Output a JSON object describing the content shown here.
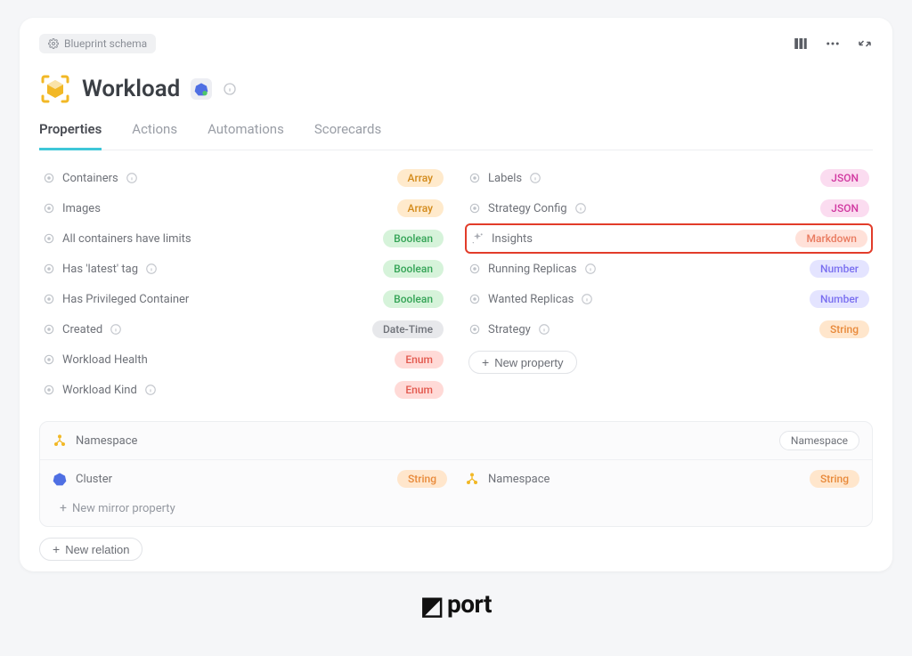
{
  "top": {
    "schema_chip": "Blueprint schema"
  },
  "title": "Workload",
  "tabs": {
    "properties": "Properties",
    "actions": "Actions",
    "automations": "Automations",
    "scorecards": "Scorecards"
  },
  "types": {
    "array": "Array",
    "json": "JSON",
    "boolean": "Boolean",
    "datetime": "Date-Time",
    "enum": "Enum",
    "number": "Number",
    "string": "String",
    "markdown": "Markdown"
  },
  "left_props": [
    {
      "name": "Containers",
      "type": "array",
      "info": true
    },
    {
      "name": "Images",
      "type": "array",
      "info": false
    },
    {
      "name": "All containers have limits",
      "type": "boolean",
      "info": false
    },
    {
      "name": "Has 'latest' tag",
      "type": "boolean",
      "info": true
    },
    {
      "name": "Has Privileged Container",
      "type": "boolean",
      "info": false
    },
    {
      "name": "Created",
      "type": "datetime",
      "info": true
    },
    {
      "name": "Workload Health",
      "type": "enum",
      "info": false
    },
    {
      "name": "Workload Kind",
      "type": "enum",
      "info": true
    }
  ],
  "right_props": [
    {
      "name": "Labels",
      "type": "json",
      "info": true,
      "ai": false
    },
    {
      "name": "Strategy Config",
      "type": "json",
      "info": true,
      "ai": false
    },
    {
      "name": "Insights",
      "type": "markdown",
      "info": false,
      "ai": true,
      "highlight": true
    },
    {
      "name": "Running Replicas",
      "type": "number",
      "info": true,
      "ai": false
    },
    {
      "name": "Wanted Replicas",
      "type": "number",
      "info": true,
      "ai": false
    },
    {
      "name": "Strategy",
      "type": "string",
      "info": true,
      "ai": false
    }
  ],
  "buttons": {
    "new_property": "New property",
    "new_mirror": "New mirror property",
    "new_relation": "New relation"
  },
  "relations": {
    "namespace_header": "Namespace",
    "namespace_badge": "Namespace",
    "cluster": {
      "label": "Cluster",
      "type": "string"
    },
    "namespace": {
      "label": "Namespace",
      "type": "string"
    }
  },
  "footer": {
    "brand": "port"
  }
}
